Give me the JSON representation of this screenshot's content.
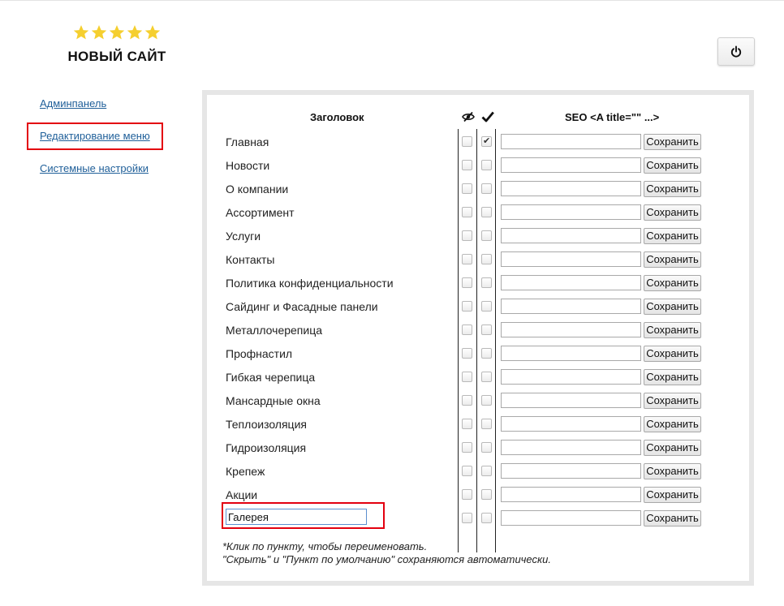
{
  "brand": {
    "site_name": "НОВЫЙ САЙТ",
    "star_count": 5,
    "star_color": "#f5cf2f"
  },
  "header_actions": {
    "power_icon": "power-icon"
  },
  "sidebar": {
    "items": [
      {
        "label": "Админпанель"
      },
      {
        "label": "Редактирование меню",
        "highlighted": true
      },
      {
        "label": "Системные настройки"
      }
    ]
  },
  "table": {
    "headers": {
      "title": "Заголовок",
      "hide_icon": "eye-slash-icon",
      "default_icon": "checkmark-icon",
      "seo": "SEO <A title=\"\" ...>"
    },
    "save_label": "Сохранить",
    "rows": [
      {
        "title": "Главная",
        "hidden": false,
        "default": true,
        "seo": ""
      },
      {
        "title": "Новости",
        "hidden": false,
        "default": false,
        "seo": ""
      },
      {
        "title": "О компании",
        "hidden": false,
        "default": false,
        "seo": ""
      },
      {
        "title": "Ассортимент",
        "hidden": false,
        "default": false,
        "seo": ""
      },
      {
        "title": "Услуги",
        "hidden": false,
        "default": false,
        "seo": ""
      },
      {
        "title": "Контакты",
        "hidden": false,
        "default": false,
        "seo": ""
      },
      {
        "title": "Политика конфиденциальности",
        "hidden": false,
        "default": false,
        "seo": ""
      },
      {
        "title": "Сайдинг и Фасадные панели",
        "hidden": false,
        "default": false,
        "seo": ""
      },
      {
        "title": "Металлочерепица",
        "hidden": false,
        "default": false,
        "seo": ""
      },
      {
        "title": "Профнастил",
        "hidden": false,
        "default": false,
        "seo": ""
      },
      {
        "title": "Гибкая черепица",
        "hidden": false,
        "default": false,
        "seo": ""
      },
      {
        "title": "Мансардные окна",
        "hidden": false,
        "default": false,
        "seo": ""
      },
      {
        "title": "Теплоизоляция",
        "hidden": false,
        "default": false,
        "seo": ""
      },
      {
        "title": "Гидроизоляция",
        "hidden": false,
        "default": false,
        "seo": ""
      },
      {
        "title": "Крепеж",
        "hidden": false,
        "default": false,
        "seo": ""
      },
      {
        "title": "Акции",
        "hidden": false,
        "default": false,
        "seo": ""
      },
      {
        "title": "Галерея",
        "hidden": false,
        "default": false,
        "seo": "",
        "editing": true
      }
    ]
  },
  "notes": {
    "line1": "*Клик по пункту, чтобы переименовать.",
    "line2": "\"Скрыть\" и \"Пункт по умолчанию\" сохраняются автоматически."
  },
  "colors": {
    "highlight": "#e3000f",
    "link": "#1f5f99",
    "panel_border": "#e6e6e6"
  }
}
